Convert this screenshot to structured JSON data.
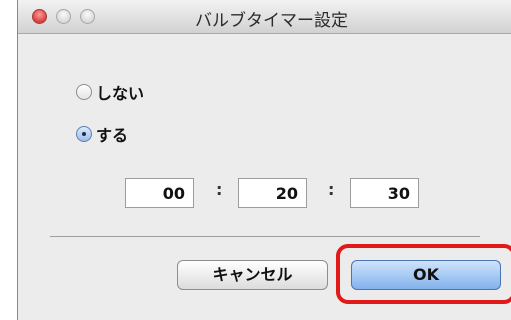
{
  "window": {
    "title": "バルブタイマー設定"
  },
  "options": [
    {
      "label": "しない",
      "selected": false
    },
    {
      "label": "する",
      "selected": true
    }
  ],
  "time": {
    "hours": "00",
    "separator": ":",
    "minutes": "20",
    "seconds": "30"
  },
  "buttons": {
    "cancel": "キャンセル",
    "ok": "OK"
  },
  "colors": {
    "highlight": "#e11919",
    "default_button": "#83b2ec"
  }
}
